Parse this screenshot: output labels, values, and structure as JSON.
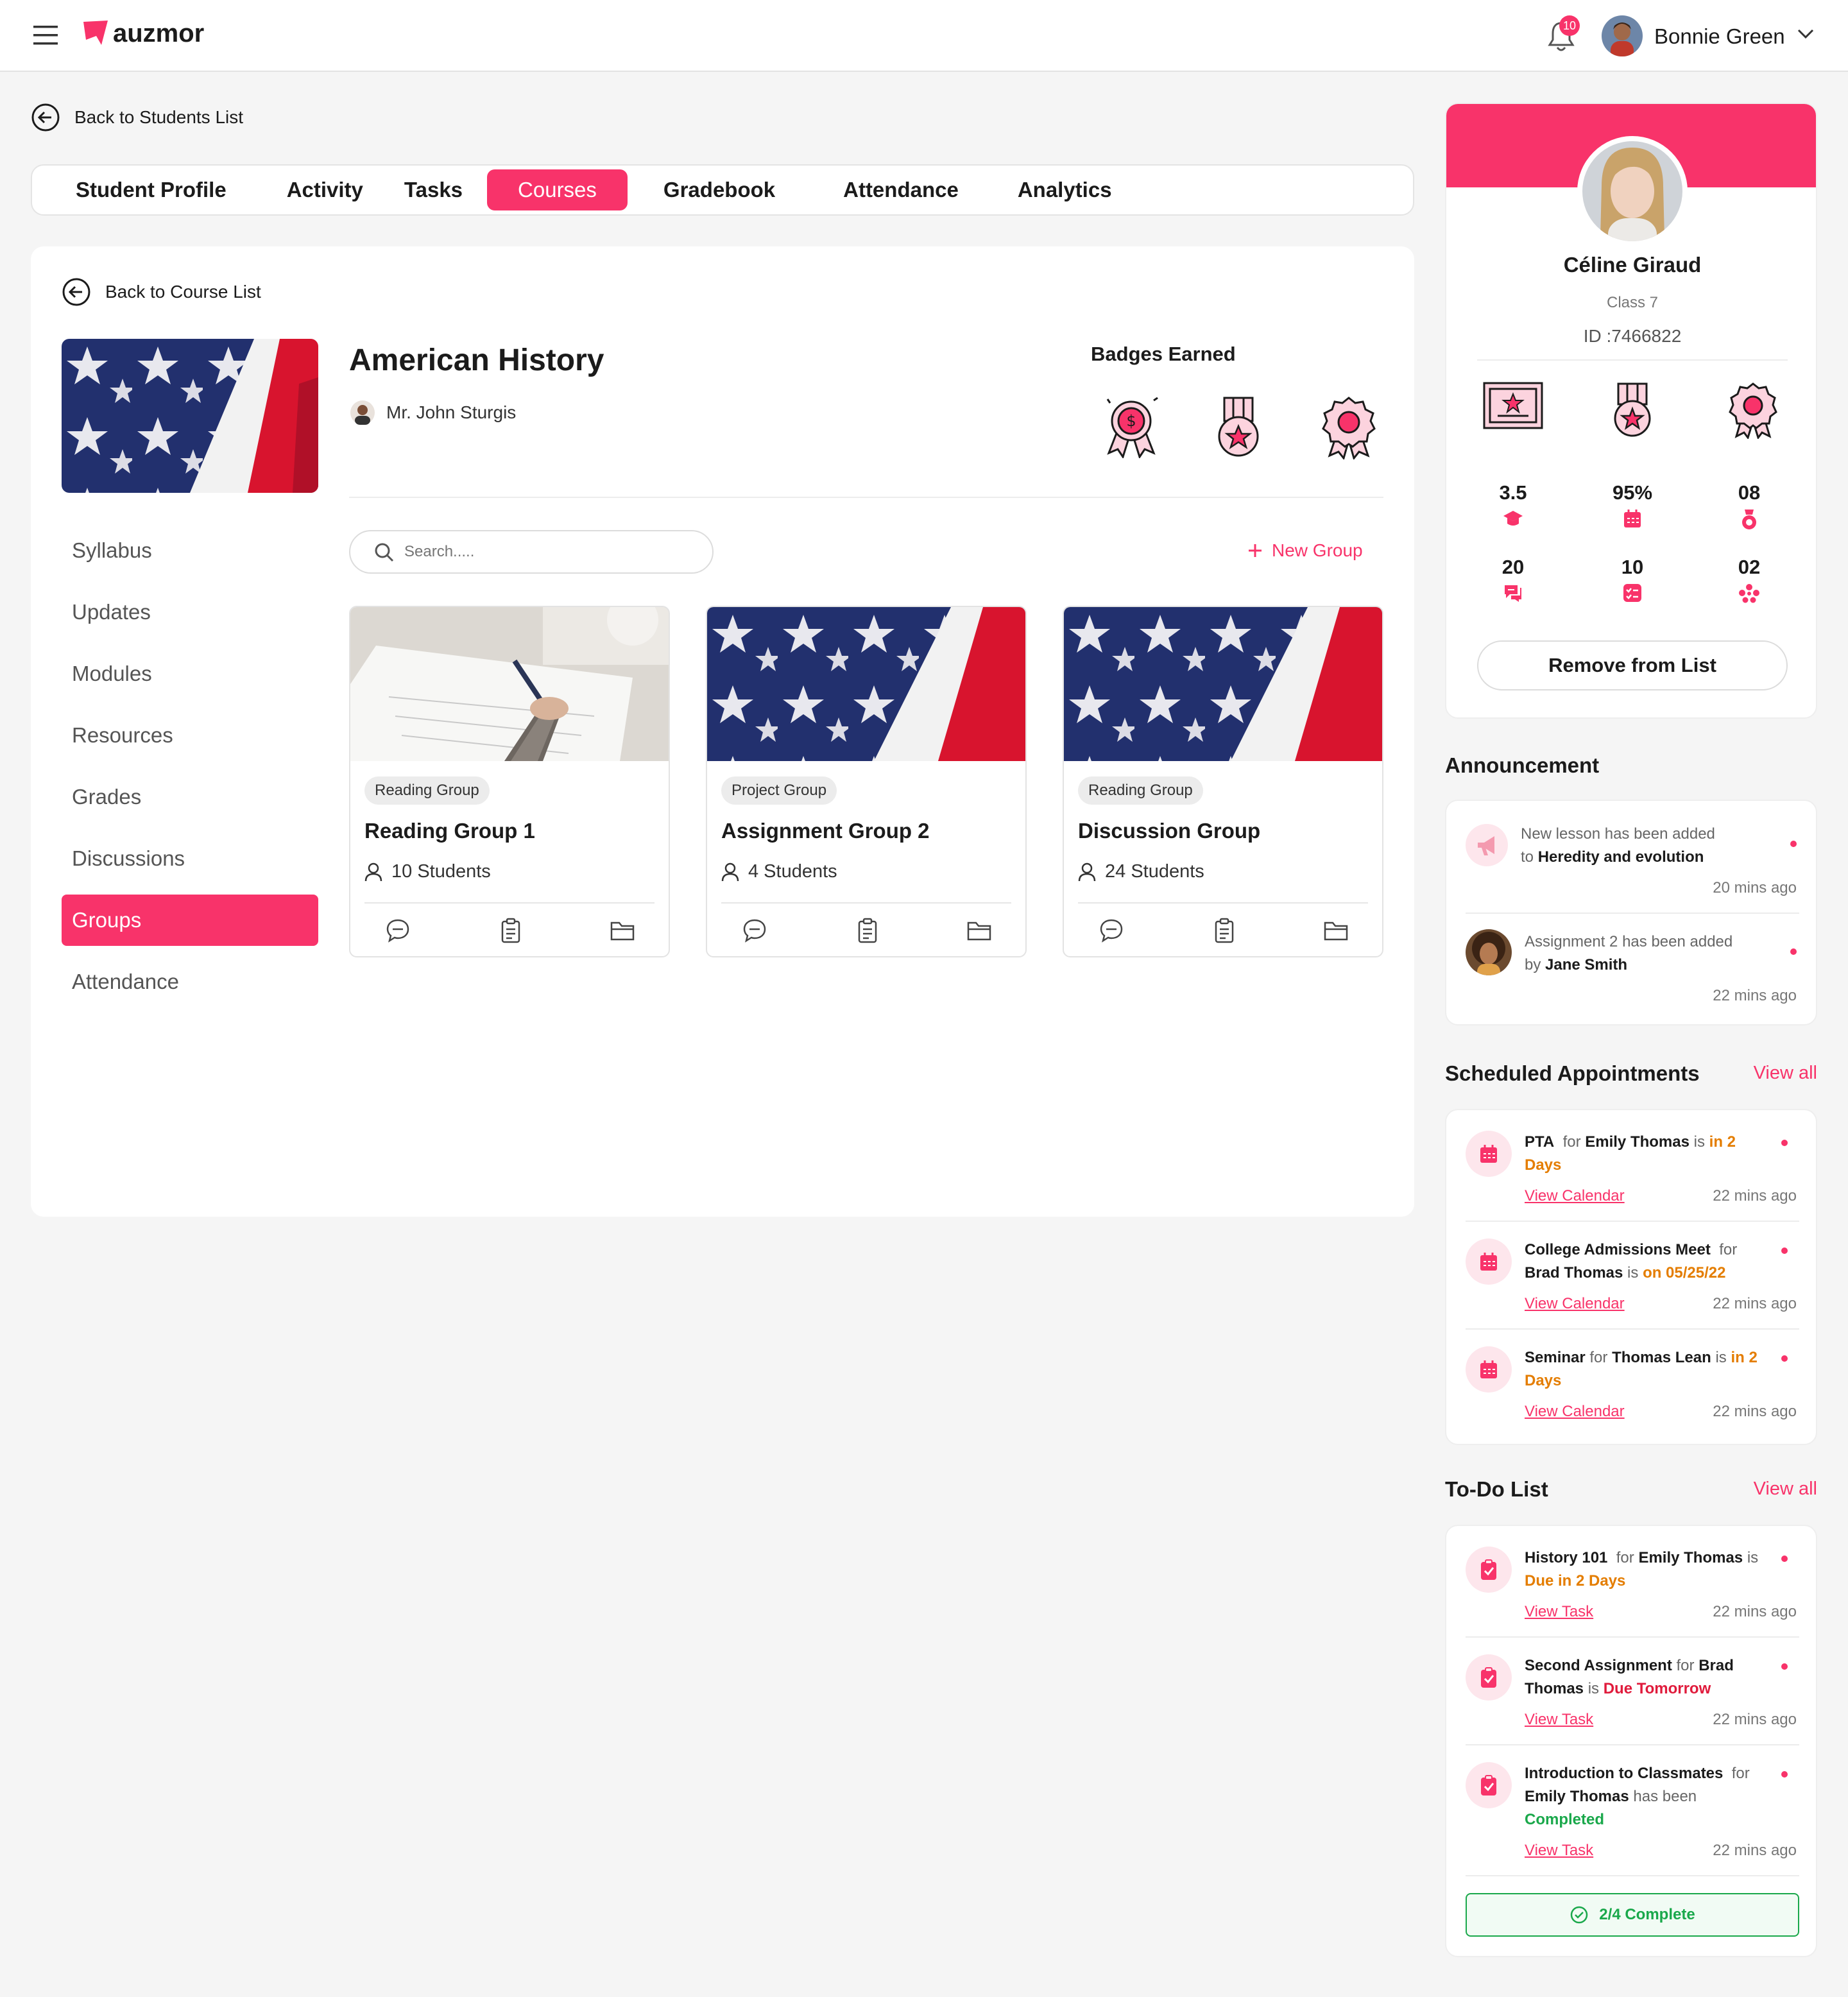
{
  "app": {
    "brand": "auzmor",
    "notifications": "10",
    "user_name": "Bonnie Green"
  },
  "nav": {
    "back_students": "Back to Students List",
    "back_courses": "Back to Course List"
  },
  "tabs": [
    {
      "label": "Student Profile"
    },
    {
      "label": "Activity"
    },
    {
      "label": "Tasks"
    },
    {
      "label": "Courses"
    },
    {
      "label": "Gradebook"
    },
    {
      "label": "Attendance"
    },
    {
      "label": "Analytics"
    }
  ],
  "course": {
    "title": "American History",
    "teacher": "Mr. John Sturgis",
    "badges_label": "Badges Earned"
  },
  "sidebar": [
    {
      "label": "Syllabus"
    },
    {
      "label": "Updates"
    },
    {
      "label": "Modules"
    },
    {
      "label": "Resources"
    },
    {
      "label": "Grades"
    },
    {
      "label": "Discussions"
    },
    {
      "label": "Groups"
    },
    {
      "label": "Attendance"
    }
  ],
  "search": {
    "placeholder": "Search....."
  },
  "new_group": "New Group",
  "groups": [
    {
      "tag": "Reading Group",
      "title": "Reading Group 1",
      "students": "10 Students"
    },
    {
      "tag": "Project Group",
      "title": "Assignment Group 2",
      "students": "4 Students"
    },
    {
      "tag": "Reading Group",
      "title": "Discussion Group",
      "students": "24 Students"
    }
  ],
  "profile": {
    "name": "Céline Giraud",
    "class": "Class 7",
    "id": "ID :7466822",
    "stats": [
      {
        "value": "3.5"
      },
      {
        "value": "95%"
      },
      {
        "value": "08"
      },
      {
        "value": "20"
      },
      {
        "value": "10"
      },
      {
        "value": "02"
      }
    ],
    "remove": "Remove from List"
  },
  "announcement": {
    "title": "Announcement",
    "items": [
      {
        "pre": "New lesson has been added",
        "mid": "to",
        "bold": "Heredity and evolution",
        "time": "20 mins ago"
      },
      {
        "pre": "Assignment 2 has been added",
        "mid": "by",
        "bold": "Jane Smith",
        "time": "22 mins ago"
      }
    ]
  },
  "appointments": {
    "title": "Scheduled Appointments",
    "view_all": "View all",
    "items": [
      {
        "event": "PTA",
        "for": "for",
        "who": "Emily Thomas",
        "is": "is",
        "status": "in 2 Days",
        "link": "View Calendar",
        "time": "22 mins ago"
      },
      {
        "event": "College Admissions Meet",
        "for": "for",
        "who": "Brad Thomas",
        "is": "is",
        "status": "on 05/25/22",
        "link": "View Calendar",
        "time": "22 mins ago"
      },
      {
        "event": "Seminar",
        "for": "for",
        "who": "Thomas Lean",
        "is": "is",
        "status": "in 2 Days",
        "link": "View Calendar",
        "time": "22 mins ago"
      }
    ]
  },
  "todo": {
    "title": "To-Do List",
    "view_all": "View all",
    "items": [
      {
        "task": "History 101",
        "for": "for",
        "who": "Emily Thomas",
        "is": "is",
        "status": "Due in 2 Days",
        "link": "View Task",
        "time": "22 mins ago"
      },
      {
        "task": "Second Assignment",
        "for": "for",
        "who": "Brad Thomas",
        "is": "is",
        "status": "Due Tomorrow",
        "link": "View Task",
        "time": "22 mins ago"
      },
      {
        "task": "Introduction to Classmates",
        "for": "for",
        "who": "Emily Thomas",
        "is": "has been",
        "status": "Completed",
        "link": "View Task",
        "time": "22 mins ago"
      }
    ],
    "complete": "2/4 Complete"
  },
  "colors": {
    "accent": "#f8336a",
    "orange": "#e47d00",
    "red": "#e01b3c",
    "green": "#1aa84b"
  }
}
